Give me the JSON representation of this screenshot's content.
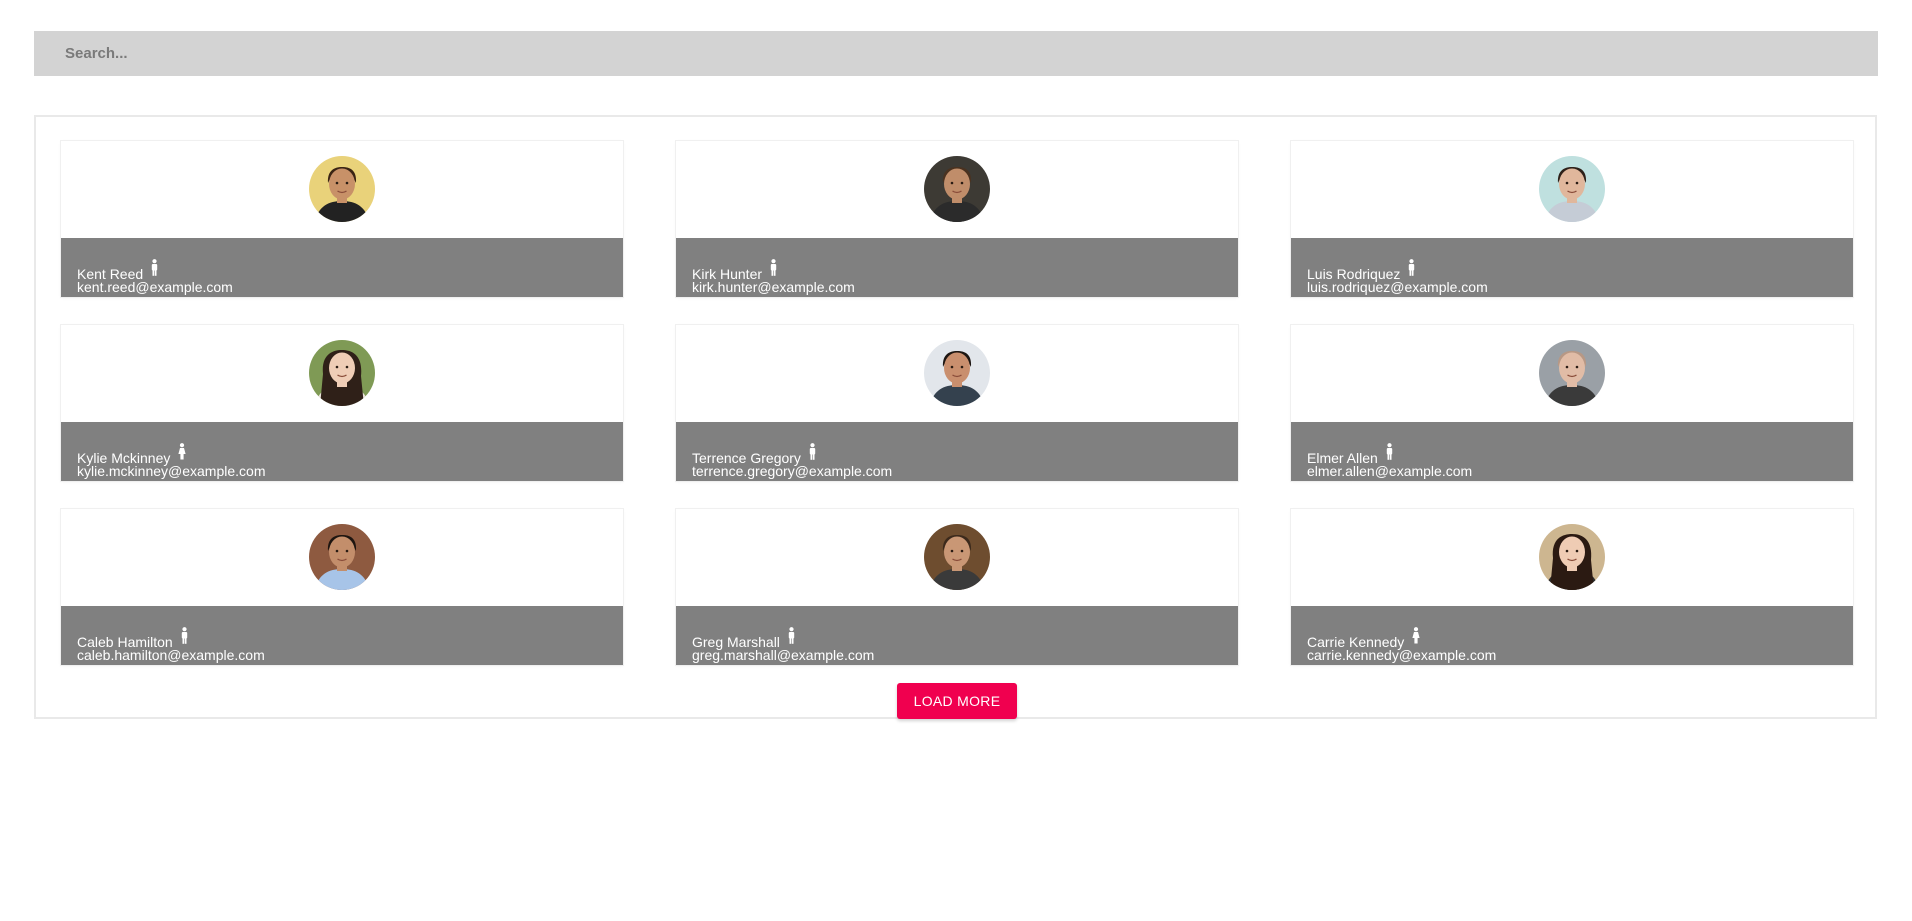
{
  "search": {
    "placeholder": "Search...",
    "value": ""
  },
  "users": [
    {
      "name": "Kent Reed",
      "email": "kent.reed@example.com",
      "gender_icon": "male-icon",
      "avatar_colors": {
        "bg": "#e9d27a",
        "skin": "#c89168",
        "hair": "#3a2414",
        "shirt": "#222222"
      }
    },
    {
      "name": "Kirk Hunter",
      "email": "kirk.hunter@example.com",
      "gender_icon": "male-icon",
      "avatar_colors": {
        "bg": "#3d3a34",
        "skin": "#c08d6a",
        "hair": "#4a3220",
        "shirt": "#2b2b2b"
      }
    },
    {
      "name": "Luis Rodriquez",
      "email": "luis.rodriquez@example.com",
      "gender_icon": "male-icon",
      "avatar_colors": {
        "bg": "#bfe0df",
        "skin": "#e0b79c",
        "hair": "#2d2019",
        "shirt": "#c5ccd6"
      }
    },
    {
      "name": "Kylie Mckinney",
      "email": "kylie.mckinney@example.com",
      "gender_icon": "female-icon",
      "avatar_colors": {
        "bg": "#7f9a55",
        "skin": "#efcdb6",
        "hair": "#2f2018",
        "shirt": "#ebe3dc"
      }
    },
    {
      "name": "Terrence Gregory",
      "email": "terrence.gregory@example.com",
      "gender_icon": "male-icon",
      "avatar_colors": {
        "bg": "#e2e6eb",
        "skin": "#c98f6e",
        "hair": "#1d1612",
        "shirt": "#34414e"
      }
    },
    {
      "name": "Elmer Allen",
      "email": "elmer.allen@example.com",
      "gender_icon": "male-icon",
      "avatar_colors": {
        "bg": "#9aa0a6",
        "skin": "#e1bca6",
        "hair": "#b79885",
        "shirt": "#3a3a3a"
      }
    },
    {
      "name": "Caleb Hamilton",
      "email": "caleb.hamilton@example.com",
      "gender_icon": "male-icon",
      "avatar_colors": {
        "bg": "#8e5a40",
        "skin": "#c38e6b",
        "hair": "#1e1510",
        "shirt": "#a7c4e8"
      }
    },
    {
      "name": "Greg Marshall",
      "email": "greg.marshall@example.com",
      "gender_icon": "male-icon",
      "avatar_colors": {
        "bg": "#6e4d2f",
        "skin": "#c99775",
        "hair": "#3c2a1c",
        "shirt": "#3a3a3a"
      }
    },
    {
      "name": "Carrie Kennedy",
      "email": "carrie.kennedy@example.com",
      "gender_icon": "female-icon",
      "avatar_colors": {
        "bg": "#cdb690",
        "skin": "#efccb4",
        "hair": "#2b1a12",
        "shirt": "#2b2b2b"
      }
    }
  ],
  "load_more": {
    "label": "LOAD MORE"
  }
}
